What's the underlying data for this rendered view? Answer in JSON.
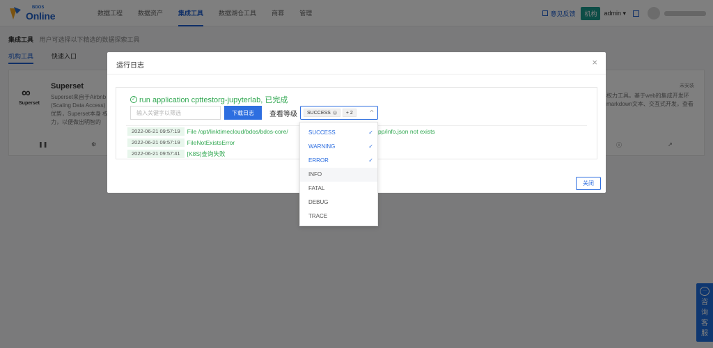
{
  "brand": {
    "small": "BDOS",
    "big": "Online"
  },
  "nav": [
    "数据工程",
    "数据资产",
    "集成工具",
    "数据湖仓工具",
    "商幂",
    "管理"
  ],
  "nav_active": 2,
  "topright": {
    "feedback": "意见反馈",
    "org": "机构",
    "user": "admin ▾"
  },
  "subheader": {
    "title": "集成工具",
    "desc": "用户可选择以下精选的数据探索工具"
  },
  "tabs": [
    "机构工具",
    "快速入口"
  ],
  "card": {
    "title": "Superset",
    "logo_text": "Superset",
    "desc_left": "Superset来自于Airbnb (Scaling Data Access) 的优势，Superset本身 权力，以便做出明智的",
    "desc_right": "权力工具。基于web的集成开发环 markdown文本、交互式开发，查看",
    "status": "未安装"
  },
  "modal": {
    "title": "运行日志",
    "close_icon": "×",
    "run_status": "run application cpttestorg-jupyterlab, 已完成",
    "search_placeholder": "输入关键字以筛选",
    "download_label": "下载日志",
    "level_label": "查看等级",
    "selected_tag": "SUCCESS",
    "more_tag": "+ 2",
    "close_label": "关闭",
    "logs": [
      {
        "time": "2022-06-21 09:57:19",
        "msg": "File /opt/linktimecloud/bdos/bdos-core/",
        "msg_tail": "pp/info.json not exists"
      },
      {
        "time": "2022-06-21 09:57:19",
        "msg": "FileNotExistsError",
        "msg_tail": ""
      },
      {
        "time": "2022-06-21 09:57:41",
        "msg": "[K8S]查询失败",
        "msg_tail": ""
      }
    ]
  },
  "levels": [
    {
      "label": "SUCCESS",
      "selected": true
    },
    {
      "label": "WARNING",
      "selected": true
    },
    {
      "label": "ERROR",
      "selected": true
    },
    {
      "label": "INFO",
      "selected": false,
      "hover": true
    },
    {
      "label": "FATAL",
      "selected": false
    },
    {
      "label": "DEBUG",
      "selected": false
    },
    {
      "label": "TRACE",
      "selected": false
    }
  ],
  "consult": [
    "咨",
    "询",
    "客",
    "服"
  ],
  "colors": {
    "primary": "#2d6ee0",
    "success": "#32a852",
    "overlay": "rgba(0,0,0,0.5)"
  }
}
